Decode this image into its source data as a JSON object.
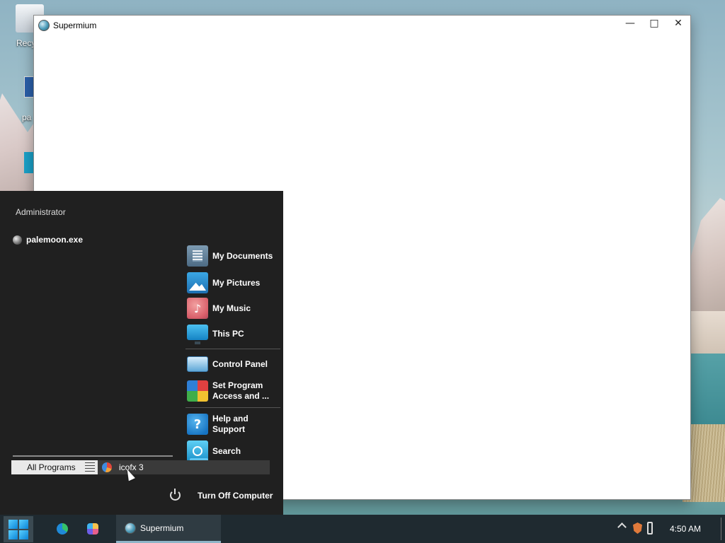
{
  "desktop": {
    "icons": [
      {
        "label": "Recy"
      },
      {
        "label": "pa"
      }
    ]
  },
  "window": {
    "title": "Supermium",
    "controls": {
      "minimize": "—",
      "maximize": "□",
      "close": "✕"
    }
  },
  "start_menu": {
    "user_name": "Administrator",
    "pinned": [
      {
        "label": "palemoon.exe",
        "icon": "palemoon-icon"
      }
    ],
    "right_items": [
      {
        "label": "My Documents",
        "icon": "documents-icon"
      },
      {
        "label": "My Pictures",
        "icon": "pictures-icon"
      },
      {
        "label": "My Music",
        "icon": "music-icon"
      },
      {
        "label": "This PC",
        "icon": "computer-icon"
      },
      {
        "label": "Control Panel",
        "icon": "control-panel-icon"
      },
      {
        "label": "Set Program Access and ...",
        "icon": "program-access-icon"
      },
      {
        "label": "Help and Support",
        "icon": "help-icon"
      },
      {
        "label": "Search",
        "icon": "search-icon"
      }
    ],
    "all_programs": "All Programs",
    "search_result": {
      "label": "icofx 3",
      "icon": "icofx-icon"
    },
    "turn_off": "Turn Off Computer"
  },
  "taskbar": {
    "pinned_icons": [
      "edge-icon",
      "copilot-icon"
    ],
    "active_app": {
      "label": "Supermium",
      "icon": "supermium-icon"
    },
    "tray_icons": [
      "chevron-up-icon",
      "brave-shield-icon",
      "usb-icon"
    ],
    "clock": "4:50 AM"
  },
  "colors": {
    "start_menu_bg": "#202020",
    "taskbar_bg": "#1f2a30",
    "accent": "#0a83d6"
  }
}
